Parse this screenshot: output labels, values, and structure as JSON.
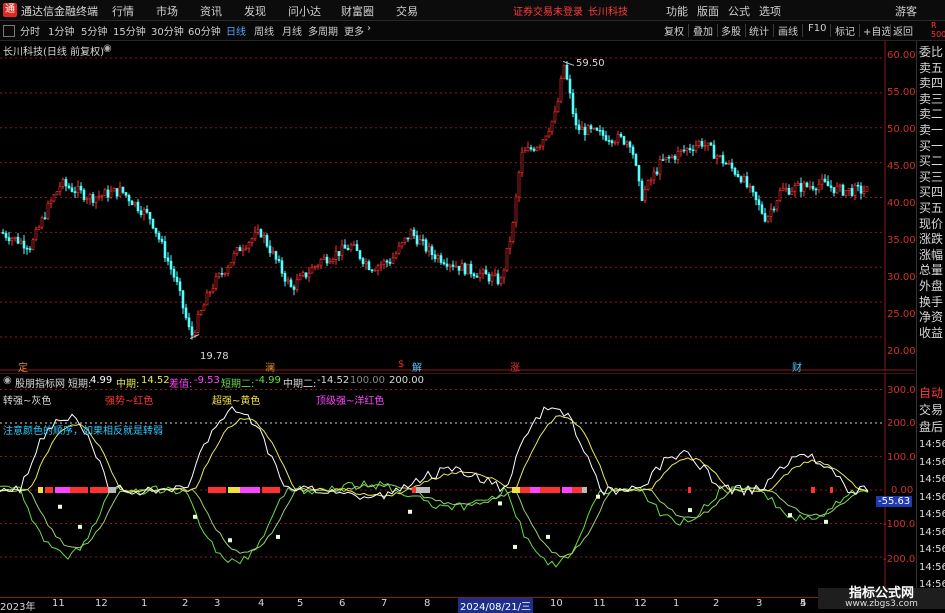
{
  "titlebar": {
    "app_name": "通达信金融终端",
    "menus": [
      "行情",
      "市场",
      "资讯",
      "发现",
      "问小达",
      "财富圈",
      "交易"
    ],
    "warning": "证券交易未登录",
    "stock_name": "长川科技",
    "right_menus": [
      "功能",
      "版面",
      "公式",
      "选项"
    ],
    "user": "游客"
  },
  "toolbar": {
    "periods": [
      "分时",
      "1分钟",
      "5分钟",
      "15分钟",
      "30分钟",
      "60分钟",
      "日线",
      "周线",
      "月线",
      "多周期",
      "更多"
    ],
    "active_period": "日线",
    "tools": [
      "复权",
      "叠加",
      "多股",
      "统计",
      "画线",
      "F10",
      "标记",
      "+自选",
      "返回"
    ]
  },
  "main_chart": {
    "title": "长川科技(日线 前复权)",
    "high_label": "59.50",
    "low_label": "19.78",
    "y_ticks": [
      "60.00",
      "55.00",
      "50.00",
      "45.00",
      "40.00",
      "35.00",
      "30.00",
      "25.00",
      "20.00"
    ],
    "events": [
      {
        "text": "定",
        "color": "#e08a2c"
      },
      {
        "text": "澜",
        "color": "#e08a2c"
      },
      {
        "text": "$",
        "color": "#e03030"
      },
      {
        "text": "解",
        "color": "#4fc3f7"
      },
      {
        "text": "涨",
        "color": "#e03030"
      },
      {
        "text": "财",
        "color": "#4fc3f7"
      }
    ]
  },
  "indicator": {
    "name": "股朋指标网",
    "short_label": "短期:",
    "short_value": "4.99",
    "mid_label": "中期:",
    "mid_value": "14.52",
    "diff_label": "差值:",
    "diff_value": "-9.53",
    "short2_label": "短期二:",
    "short2_value": "-4.99",
    "mid2_label": "中期二:",
    "mid2_value": "-14.52",
    "c100": "100.00",
    "c200": "200.00",
    "legend_gray": "转强~灰色",
    "legend_red": "强势~红色",
    "legend_yellow": "超强~黄色",
    "legend_magenta": "顶级强~洋红色",
    "note": "注意颜色的顺序，如果相反就是转弱",
    "y_ticks": [
      "300.0",
      "200.0",
      "100.0",
      "0.00",
      "-100.0",
      "-200.0"
    ],
    "current_value": "-55.63"
  },
  "right_panel": {
    "r_label": "R",
    "r_num": "500",
    "tabs": [
      "委比",
      "卖五",
      "卖四",
      "卖三",
      "卖二",
      "卖一",
      "买一",
      "买二",
      "买三",
      "买四",
      "买五",
      "现价",
      "涨跌",
      "涨幅",
      "总量",
      "外盘",
      "换手",
      "净资",
      "收益"
    ],
    "tabs2": [
      "自动",
      "交易",
      "盘后"
    ],
    "times": [
      "14:56",
      "14:56",
      "14:56",
      "14:56",
      "14:56",
      "14:56",
      "14:56",
      "14:56",
      "14:56"
    ]
  },
  "x_axis": {
    "labels": [
      "2023年",
      "11",
      "12",
      "1",
      "2",
      "3",
      "4",
      "5",
      "6",
      "7",
      "8",
      "2024/08/21/三",
      "10",
      "11",
      "12",
      "1",
      "2",
      "3",
      "4",
      "5"
    ],
    "highlight": "2024/08/21/三"
  },
  "watermark": {
    "title": "指标公式网",
    "url": "www.zbgs3.com"
  },
  "colors": {
    "up": "#ff3232",
    "down": "#54ffff",
    "grid": "#8a1a1a",
    "white_line": "#ffffff",
    "yellow_line": "#e8e85a",
    "green_line": "#66dd44"
  }
}
